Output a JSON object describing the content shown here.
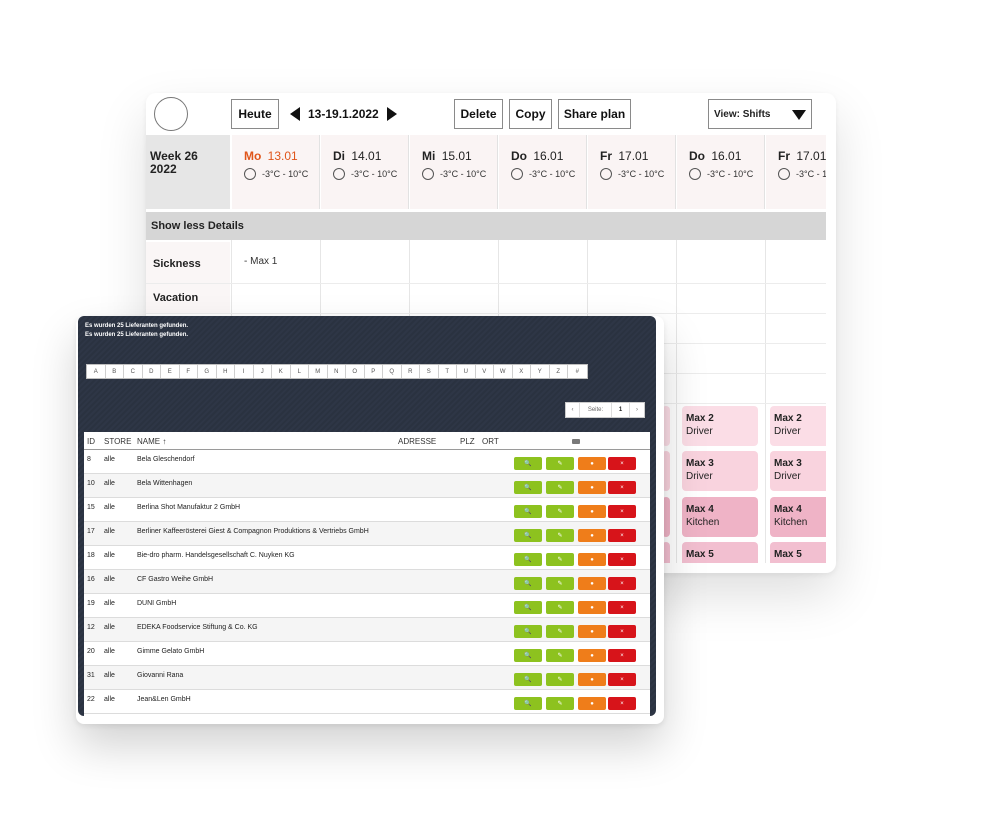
{
  "planner": {
    "today_label": "Heute",
    "date_range": "13-19.1.2022",
    "delete_label": "Delete",
    "copy_label": "Copy",
    "share_label": "Share plan",
    "view_label": "View: Shifts",
    "week_label": "Week 26",
    "week_year": "2022",
    "days": [
      {
        "name": "Mo",
        "date": "13.01",
        "weather": "-3°C - 10°C"
      },
      {
        "name": "Di",
        "date": "14.01",
        "weather": "-3°C - 10°C"
      },
      {
        "name": "Mi",
        "date": "15.01",
        "weather": "-3°C - 10°C"
      },
      {
        "name": "Do",
        "date": "16.01",
        "weather": "-3°C - 10°C"
      },
      {
        "name": "Fr",
        "date": "17.01",
        "weather": "-3°C - 10°C"
      },
      {
        "name": "Do",
        "date": "16.01",
        "weather": "-3°C - 10°C"
      },
      {
        "name": "Fr",
        "date": "17.01",
        "weather": "-3°C - 10°C"
      }
    ],
    "details_label": "Show less Details",
    "rows": {
      "sickness": "Sickness",
      "vacation": "Vacation"
    },
    "sickness_entry": "- Max 1",
    "shifts": [
      {
        "name": "Max 2",
        "role": "Driver"
      },
      {
        "name": "Max 3",
        "role": "Driver"
      },
      {
        "name": "Max 4",
        "role": "Kitchen"
      },
      {
        "name": "Max 5",
        "role": ""
      }
    ],
    "colors": {
      "today": "#e0551a",
      "shift_light": "#fbdde6",
      "shift_mid": "#f6c9d6",
      "shift_dark": "#efb3c6"
    }
  },
  "suppliers": {
    "found_text": "Es wurden 25 Lieferanten gefunden.",
    "alphabet": [
      "A",
      "B",
      "C",
      "D",
      "E",
      "F",
      "G",
      "H",
      "I",
      "J",
      "K",
      "L",
      "M",
      "N",
      "O",
      "P",
      "Q",
      "R",
      "S",
      "T",
      "U",
      "V",
      "W",
      "X",
      "Y",
      "Z",
      "#"
    ],
    "pager": {
      "prev": "‹",
      "label": "Seite:",
      "page": "1",
      "next": "›"
    },
    "columns": {
      "id": "ID",
      "store": "STORE",
      "name": "NAME ↑",
      "address": "ADRESSE",
      "plz": "PLZ",
      "city": "ORT"
    },
    "rows": [
      {
        "id": "8",
        "store": "alle",
        "name": "Bela Gleschendorf"
      },
      {
        "id": "10",
        "store": "alle",
        "name": "Bela Wittenhagen"
      },
      {
        "id": "15",
        "store": "alle",
        "name": "Berlina Shot Manufaktur 2 GmbH"
      },
      {
        "id": "17",
        "store": "alle",
        "name": "Berliner Kaffeerösterei Giest & Compagnon Produktions & Vertriebs GmbH"
      },
      {
        "id": "18",
        "store": "alle",
        "name": "Bie-dro pharm. Handelsgesellschaft C. Nuyken KG"
      },
      {
        "id": "16",
        "store": "alle",
        "name": "CF Gastro Weihe GmbH"
      },
      {
        "id": "19",
        "store": "alle",
        "name": "DUNI GmbH"
      },
      {
        "id": "12",
        "store": "alle",
        "name": "EDEKA Foodservice Stiftung & Co. KG"
      },
      {
        "id": "20",
        "store": "alle",
        "name": "Gimme Gelato GmbH"
      },
      {
        "id": "31",
        "store": "alle",
        "name": "Giovanni Rana"
      },
      {
        "id": "22",
        "store": "alle",
        "name": "Jean&Len GmbH"
      }
    ],
    "actions": {
      "view": "🔍",
      "edit": "✎",
      "lock": "●",
      "delete": "×"
    },
    "colors": {
      "panel": "#2b3342",
      "view": "#8dc21f",
      "edit": "#8dc21f",
      "lock": "#ef7d1a",
      "delete": "#d7141a"
    }
  }
}
